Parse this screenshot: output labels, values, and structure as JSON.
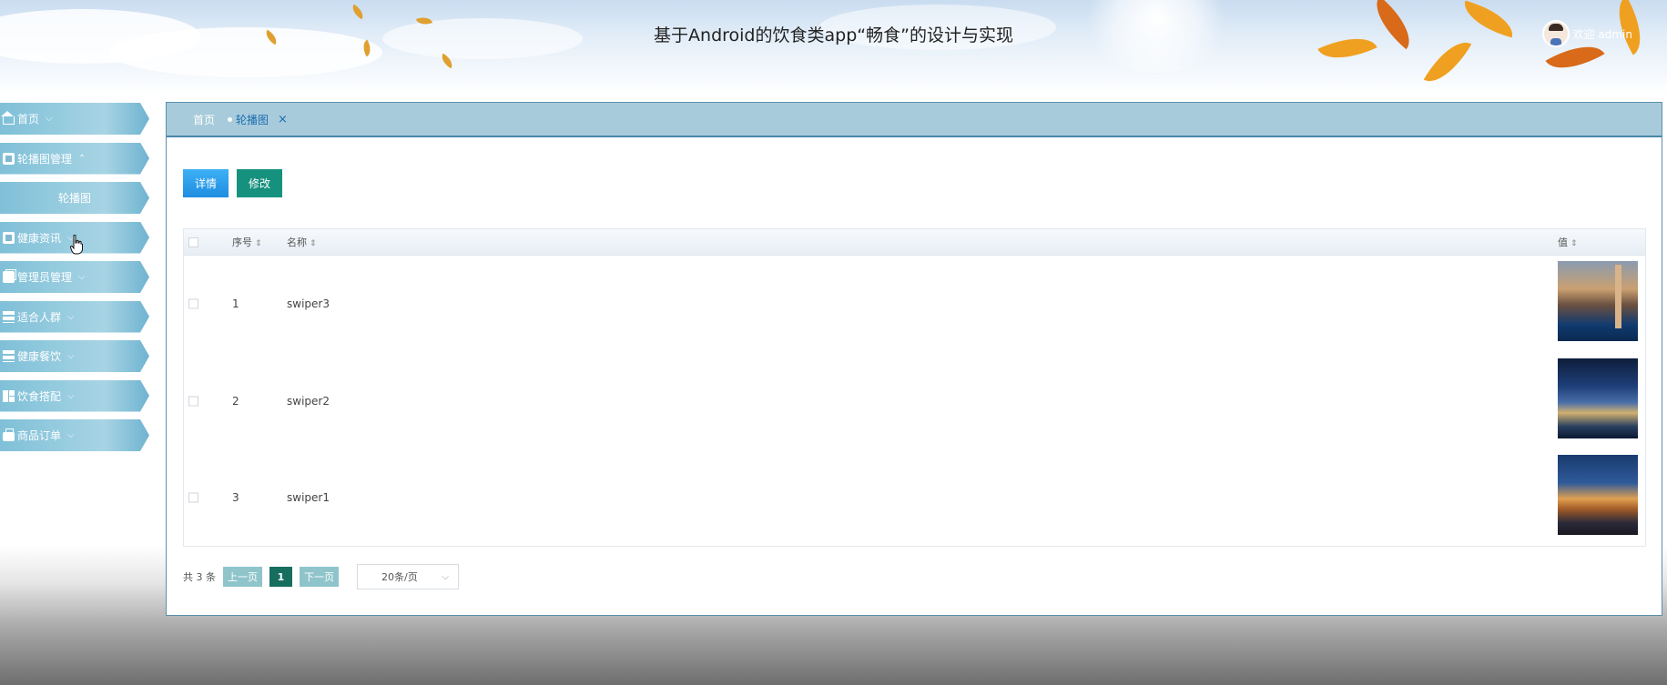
{
  "header": {
    "title": "基于Android的饮食类app“畅食”的设计与实现",
    "welcome": "欢迎 admin"
  },
  "sidebar": {
    "items": [
      {
        "label": "首页",
        "icon": "home-icon",
        "chevron": "⌵"
      },
      {
        "label": "轮播图管理",
        "icon": "document-icon",
        "chevron": "⌃"
      },
      {
        "label": "轮播图",
        "icon": "",
        "chevron": ""
      },
      {
        "label": "健康资讯",
        "icon": "document-icon",
        "chevron": "⌵"
      },
      {
        "label": "管理员管理",
        "icon": "copy-icon",
        "chevron": "⌵"
      },
      {
        "label": "适合人群",
        "icon": "list-icon",
        "chevron": "⌵"
      },
      {
        "label": "健康餐饮",
        "icon": "list-icon",
        "chevron": "⌵"
      },
      {
        "label": "饮食搭配",
        "icon": "grid-icon",
        "chevron": "⌵"
      },
      {
        "label": "商品订单",
        "icon": "bag-icon",
        "chevron": "⌵"
      }
    ]
  },
  "tabs": {
    "home": "首页",
    "active": "轮播图",
    "close": "×"
  },
  "toolbar": {
    "detail_label": "详情",
    "edit_label": "修改"
  },
  "table": {
    "columns": {
      "index": "序号",
      "name": "名称",
      "value": "值",
      "sort_glyph": "⇕"
    },
    "rows": [
      {
        "index": "1",
        "name": "swiper3"
      },
      {
        "index": "2",
        "name": "swiper2"
      },
      {
        "index": "3",
        "name": "swiper1"
      }
    ]
  },
  "pager": {
    "total": "共 3 条",
    "prev": "上一页",
    "current": "1",
    "next": "下一页",
    "page_size": "20条/页",
    "caret": "⌵"
  },
  "colors": {
    "accent": "#1f8de0",
    "edit": "#16917e",
    "tabbar": "#a8cbdb",
    "nav": "#7fc0d8"
  }
}
